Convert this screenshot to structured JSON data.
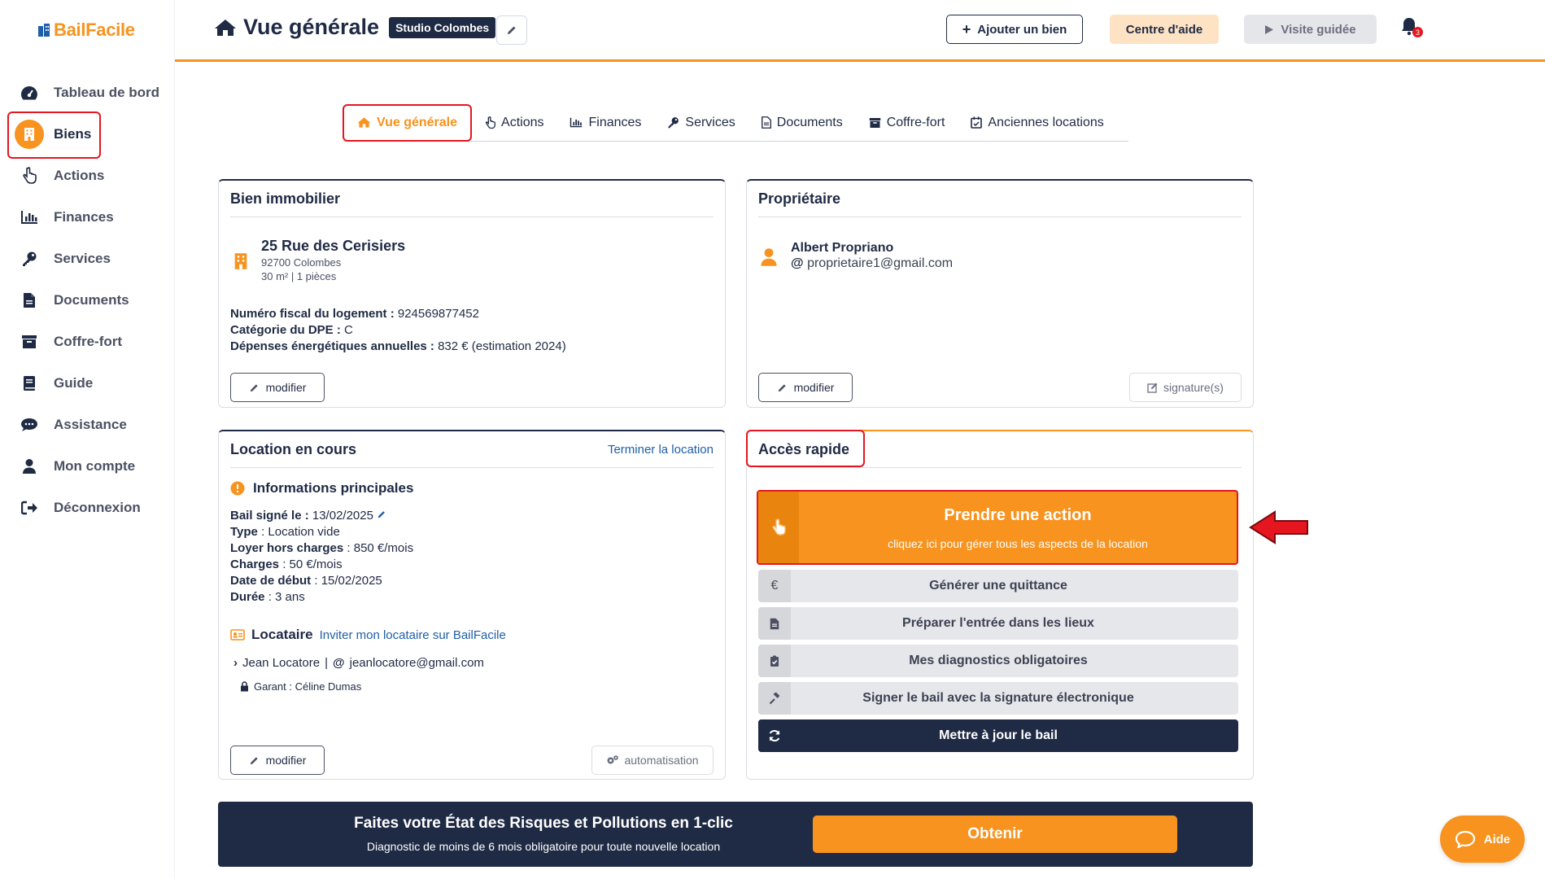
{
  "app": {
    "logo_text": "BailFacile"
  },
  "sidebar": {
    "items": [
      {
        "label": "Tableau de bord",
        "icon": "gauge-icon"
      },
      {
        "label": "Biens",
        "icon": "building-icon",
        "active": true
      },
      {
        "label": "Actions",
        "icon": "hand-pointer-icon"
      },
      {
        "label": "Finances",
        "icon": "bar-chart-icon"
      },
      {
        "label": "Services",
        "icon": "key-icon"
      },
      {
        "label": "Documents",
        "icon": "file-icon"
      },
      {
        "label": "Coffre-fort",
        "icon": "archive-icon"
      },
      {
        "label": "Guide",
        "icon": "book-icon"
      },
      {
        "label": "Assistance",
        "icon": "chat-icon"
      },
      {
        "label": "Mon compte",
        "icon": "user-icon"
      },
      {
        "label": "Déconnexion",
        "icon": "sign-out-icon"
      }
    ]
  },
  "header": {
    "title": "Vue générale",
    "badge": "Studio Colombes",
    "add_label": "Ajouter un bien",
    "help_label": "Centre d'aide",
    "tour_label": "Visite guidée",
    "notif_count": "3"
  },
  "tabs": [
    {
      "label": "Vue générale",
      "active": true
    },
    {
      "label": "Actions"
    },
    {
      "label": "Finances"
    },
    {
      "label": "Services"
    },
    {
      "label": "Documents"
    },
    {
      "label": "Coffre-fort"
    },
    {
      "label": "Anciennes locations"
    }
  ],
  "property": {
    "title": "Bien immobilier",
    "address": "25 Rue des Cerisiers",
    "city": "92700 Colombes",
    "surface": "30 m² | 1 pièces",
    "fiscal_label": "Numéro fiscal du logement :",
    "fiscal_value": " 924569877452",
    "dpe_label": "Catégorie du DPE :",
    "dpe_value": " C",
    "energy_label": "Dépenses énergétiques annuelles :",
    "energy_value": " 832 € (estimation 2024)",
    "edit_label": "modifier"
  },
  "owner": {
    "title": "Propriétaire",
    "name": "Albert Propriano",
    "email": "proprietaire1@gmail.com",
    "edit_label": "modifier",
    "signature_label": "signature(s)"
  },
  "rental": {
    "title": "Location en cours",
    "end_link": "Terminer la location",
    "section_title": "Informations principales",
    "rows": [
      {
        "label": "Bail signé le :",
        "value": " 13/02/2025"
      },
      {
        "label": "Type",
        "value": " : Location vide"
      },
      {
        "label": "Loyer hors charges",
        "value": " : 850 €/mois"
      },
      {
        "label": "Charges",
        "value": " : 50 €/mois"
      },
      {
        "label": "Date de début",
        "value": " : 15/02/2025"
      },
      {
        "label": "Durée",
        "value": " : 3 ans"
      }
    ],
    "tenant_title": "Locataire",
    "invite_link": "Inviter mon locataire sur BailFacile",
    "tenant_name": "Jean Locatore",
    "tenant_email": "jeanlocatore@gmail.com",
    "guarantor": "Garant : Céline Dumas",
    "edit_label": "modifier",
    "automation_label": "automatisation"
  },
  "quick_access": {
    "title": "Accès rapide",
    "main_title": "Prendre une action",
    "main_sub": "cliquez ici pour gérer tous les aspects de la location",
    "items": [
      {
        "label": "Générer une quittance",
        "icon": "euro-icon"
      },
      {
        "label": "Préparer l'entrée dans les lieux",
        "icon": "file-icon"
      },
      {
        "label": "Mes diagnostics obligatoires",
        "icon": "clipboard-check-icon"
      },
      {
        "label": "Signer le bail avec la signature électronique",
        "icon": "gavel-icon"
      },
      {
        "label": "Mettre à jour le bail",
        "icon": "refresh-icon"
      }
    ]
  },
  "banner": {
    "title": "Faites votre État des Risques et Pollutions en 1-clic",
    "subtitle": "Diagnostic de moins de 6 mois obligatoire pour toute nouvelle location",
    "button": "Obtenir"
  },
  "aide_label": "Aide",
  "colors": {
    "accent": "#f7931e",
    "navy": "#1f2a44",
    "highlight": "#e5161f"
  }
}
